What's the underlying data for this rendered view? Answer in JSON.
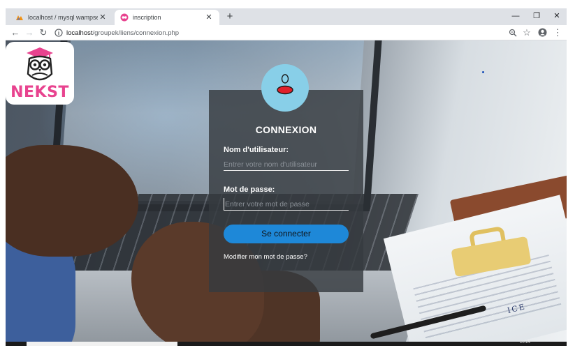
{
  "browser": {
    "tabs": [
      {
        "title": "localhost / mysql wampserver / s",
        "icon": "phpmyadmin-icon",
        "active": false
      },
      {
        "title": "inscription",
        "icon": "site-icon",
        "active": true
      }
    ],
    "url": {
      "host": "localhost",
      "path": "/groupek/liens/connexion.php"
    }
  },
  "logo": {
    "text": "NEKST"
  },
  "form": {
    "title": "CONNEXION",
    "username_label": "Nom d'utilisateur:",
    "username_placeholder": "Entrer votre nom d'utilisateur",
    "password_label": "Mot de passe:",
    "password_placeholder": "Entrer votre mot de passe",
    "submit_label": "Se connecter",
    "forgot_link": "Modifier mon mot de passe?"
  },
  "background": {
    "invoice_text": "ICE"
  },
  "taskbar": {
    "clock": "10:24"
  },
  "colors": {
    "card_bg": "#363a40",
    "avatar_circle": "#88cfe8",
    "button": "#1e88d8",
    "logo_pink": "#e8438f"
  }
}
